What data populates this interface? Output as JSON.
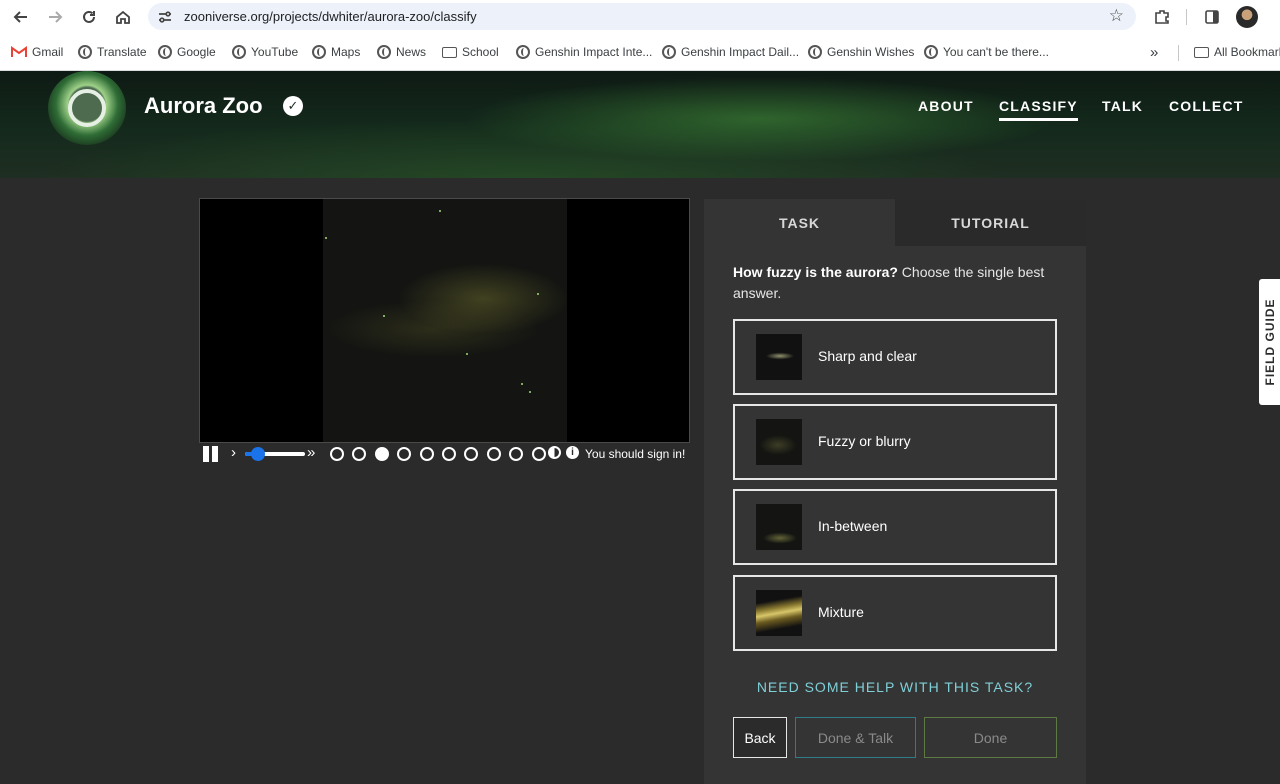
{
  "browser": {
    "url": "zooniverse.org/projects/dwhiter/aurora-zoo/classify",
    "icons": [
      "back-icon",
      "forward-icon",
      "reload-icon",
      "home-icon",
      "site-settings-icon",
      "star-icon",
      "extensions-icon",
      "side-panel-icon",
      "profile-avatar"
    ]
  },
  "bookmarks": {
    "items": [
      {
        "label": "Gmail",
        "icon": "gmail-icon"
      },
      {
        "label": "Translate",
        "icon": "globe-icon"
      },
      {
        "label": "Google",
        "icon": "globe-icon"
      },
      {
        "label": "YouTube",
        "icon": "globe-icon"
      },
      {
        "label": "Maps",
        "icon": "globe-icon"
      },
      {
        "label": "News",
        "icon": "globe-icon"
      },
      {
        "label": "School",
        "icon": "folder-icon"
      },
      {
        "label": "Genshin Impact Inte...",
        "icon": "globe-icon"
      },
      {
        "label": "Genshin Impact Dail...",
        "icon": "globe-icon"
      },
      {
        "label": "Genshin Wishes",
        "icon": "globe-icon"
      },
      {
        "label": "You can't be there...",
        "icon": "globe-icon"
      }
    ],
    "overflow": "»",
    "all_bookmarks": "All Bookmarks"
  },
  "header": {
    "title": "Aurora Zoo",
    "verified": "✓",
    "nav": [
      "ABOUT",
      "CLASSIFY",
      "TALK",
      "COLLECT"
    ],
    "active_nav": "CLASSIFY"
  },
  "viewer": {
    "frame_count": 10,
    "current_frame": 3,
    "speed_fraction": 0.22,
    "sign_in_message": "You should sign in!"
  },
  "task": {
    "tabs": [
      "TASK",
      "TUTORIAL"
    ],
    "active_tab": "TASK",
    "question_bold": "How fuzzy is the aurora?",
    "question_rest": " Choose the single best answer.",
    "answers": [
      {
        "label": "Sharp and clear"
      },
      {
        "label": "Fuzzy or blurry"
      },
      {
        "label": "In-between"
      },
      {
        "label": "Mixture"
      }
    ],
    "help": "NEED SOME HELP WITH THIS TASK?",
    "buttons": {
      "back": "Back",
      "done_talk": "Done & Talk",
      "done": "Done"
    }
  },
  "field_guide": "FIELD GUIDE",
  "colors": {
    "page_bg": "#2b2b2b",
    "panel_bg": "#343434",
    "accent_link": "#7fcfd7",
    "slider": "#1a73e8"
  }
}
